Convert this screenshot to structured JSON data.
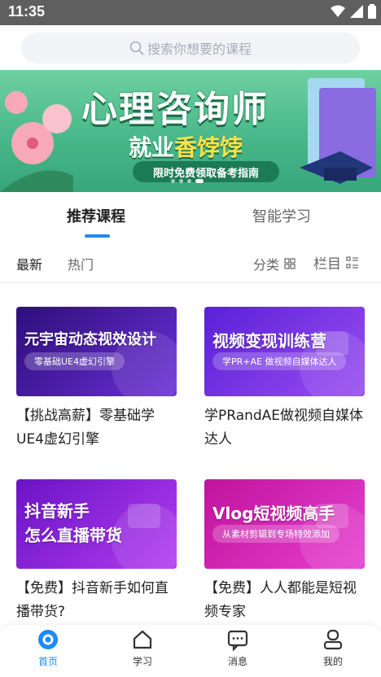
{
  "status": {
    "time": "11:35"
  },
  "search": {
    "placeholder": "搜索你想要的课程"
  },
  "banner": {
    "title": "心理咨询师",
    "sub_prefix": "就业",
    "sub_highlight": "香饽饽",
    "pill": "限时免费领取备考指南"
  },
  "tabs": [
    {
      "label": "推荐课程",
      "active": true
    },
    {
      "label": "智能学习",
      "active": false
    }
  ],
  "filters": {
    "latest": "最新",
    "hot": "热门",
    "category": "分类",
    "columns": "栏目"
  },
  "courses": [
    {
      "thumb_title": "元宇宙动态视效设计",
      "thumb_tag": "零基础UE4虚幻引擎",
      "title": "【挑战高薪】零基础学UE4虚幻引擎",
      "color": "#4b1fa8"
    },
    {
      "thumb_title": "视频变现训练营",
      "thumb_tag": "学PR+AE 做视频自媒体达人",
      "title": "学PRandAE做视频自媒体达人",
      "color": "#7b2ee0"
    },
    {
      "thumb_title": "抖音新手\n怎么直播带货",
      "thumb_tag": "",
      "title": "【免费】抖音新手如何直播带货?",
      "color": "#8a1fd0"
    },
    {
      "thumb_title": "Vlog短视频高手",
      "thumb_tag": "从素材剪辑到专场特效添加",
      "title": "【免费】人人都能是短视频专家",
      "color": "#d11fb3"
    }
  ],
  "nav": [
    {
      "label": "首页",
      "icon": "home-icon",
      "active": true
    },
    {
      "label": "学习",
      "icon": "study-icon",
      "active": false
    },
    {
      "label": "消息",
      "icon": "message-icon",
      "active": false
    },
    {
      "label": "我的",
      "icon": "profile-icon",
      "active": false
    }
  ],
  "colors": {
    "accent": "#1e8bf1",
    "banner_green": "#46b688"
  }
}
